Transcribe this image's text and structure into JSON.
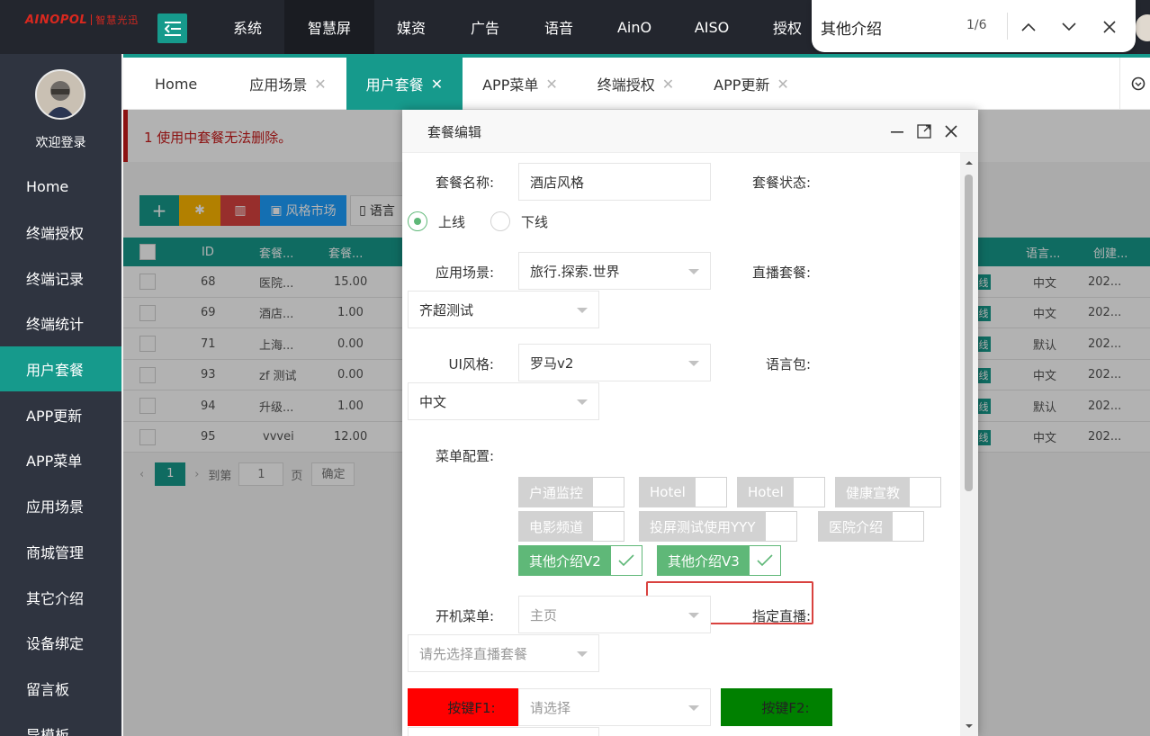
{
  "header": {
    "logo_text": "AINOPOL",
    "logo_cn": "智慧光迅",
    "nav": [
      "系统",
      "智慧屏",
      "媒资",
      "广告",
      "语音",
      "AinO",
      "AISO",
      "授权"
    ],
    "active_nav": "智慧屏"
  },
  "find_bar": {
    "query": "其他介绍",
    "count": "1/6"
  },
  "sidebar": {
    "welcome": "欢迎登录",
    "items": [
      "Home",
      "终端授权",
      "终端记录",
      "终端统计",
      "用户套餐",
      "APP更新",
      "APP菜单",
      "应用场景",
      "商城管理",
      "其它介绍",
      "设备绑定",
      "留言板",
      "导模板"
    ],
    "active": "用户套餐"
  },
  "tabs": [
    {
      "label": "Home",
      "closable": false
    },
    {
      "label": "应用场景",
      "closable": true
    },
    {
      "label": "用户套餐",
      "closable": true,
      "active": true
    },
    {
      "label": "APP菜单",
      "closable": true
    },
    {
      "label": "终端授权",
      "closable": true
    },
    {
      "label": "APP更新",
      "closable": true
    }
  ],
  "background_page": {
    "notice": "1 使用中套餐无法删除。",
    "toolbar": {
      "market_label": "风格市场",
      "lang_label": "语言"
    },
    "table": {
      "headers": [
        "ID",
        "套餐...",
        "套餐...",
        "语言...",
        "创建..."
      ],
      "rows": [
        {
          "id": "68",
          "name": "医院...",
          "price": "15.00",
          "tag": "线",
          "lang": "中文",
          "created": "202..."
        },
        {
          "id": "69",
          "name": "酒店...",
          "price": "1.00",
          "tag": "线",
          "lang": "中文",
          "created": "202..."
        },
        {
          "id": "71",
          "name": "上海...",
          "price": "0.00",
          "tag": "线",
          "lang": "默认",
          "created": "202..."
        },
        {
          "id": "93",
          "name": "zf 测试",
          "price": "0.00",
          "tag": "线",
          "lang": "中文",
          "created": "202..."
        },
        {
          "id": "94",
          "name": "升级...",
          "price": "1.00",
          "tag": "线",
          "lang": "默认",
          "created": "202..."
        },
        {
          "id": "95",
          "name": "vvvei",
          "price": "12.00",
          "tag": "线",
          "lang": "中文",
          "created": "202..."
        }
      ]
    },
    "pager": {
      "current": "1",
      "goto_label": "到第",
      "page_value": "1",
      "page_unit": "页",
      "confirm": "确定"
    }
  },
  "modal": {
    "title": "套餐编辑",
    "fields": {
      "name_label": "套餐名称:",
      "name_value": "酒店风格",
      "status_label": "套餐状态:",
      "status_options": [
        "上线",
        "下线"
      ],
      "status_selected": "上线",
      "scene_label": "应用场景:",
      "scene_value": "旅行.探索.世界",
      "live_label": "直播套餐:",
      "live_value": "齐超测试",
      "ui_label": "UI风格:",
      "ui_value": "罗马v2",
      "lang_label": "语言包:",
      "lang_value": "中文",
      "menu_label": "菜单配置:",
      "boot_label": "开机菜单:",
      "boot_value": "主页",
      "channel_label": "指定直播:",
      "channel_placeholder": "请先选择直播套餐",
      "f1_label": "按键F1:",
      "f1_placeholder": "请选择",
      "f2_label": "按键F2:"
    },
    "menu_items": [
      {
        "label": "户通监控",
        "checked": false
      },
      {
        "label": "Hotel",
        "checked": false
      },
      {
        "label": "Hotel",
        "checked": false
      },
      {
        "label": "健康宣教",
        "checked": false
      },
      {
        "label": "电影频道",
        "checked": false
      },
      {
        "label": "投屏测试使用YYY",
        "checked": false
      },
      {
        "label": "医院介绍",
        "checked": false
      },
      {
        "label": "其他介绍V2",
        "checked": true
      },
      {
        "label": "其他介绍V3",
        "checked": true
      }
    ]
  },
  "colors": {
    "primary": "#169a8c",
    "check_green": "#5fb878",
    "danger": "#c91a1a",
    "f1_bg": "#ff0000",
    "f2_bg": "#008000",
    "highlight_border": "#d9423f"
  }
}
